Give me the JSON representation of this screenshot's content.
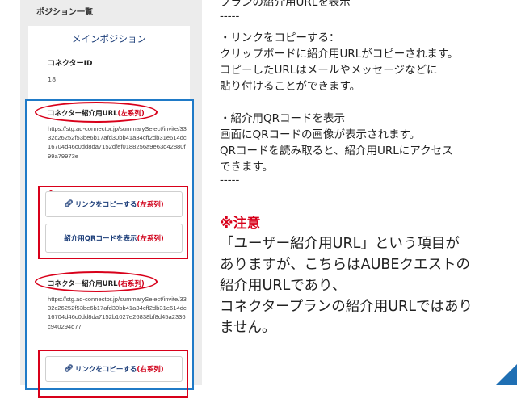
{
  "phone": {
    "section_title": "ポジション一覧",
    "main_position": "メインポジション",
    "connector_id_label": "コネクターID",
    "connector_id_value": "18",
    "left_url_label": "コネクター紹介用URL",
    "left_url_tag": "(左系列)",
    "left_url": "https://stg.aq-connector.jp/summarySelect/invite/3332c26252f53be6b17afd30bb41a34cff2db31e614dc16704d46c0dd8da7152dfef0188256a9e63d42880f99a79973e",
    "copy_left_label": "リンクをコピーする",
    "copy_left_tag": "(左系列)",
    "qr_left_label": "紹介用QRコードを表示",
    "qr_left_tag": "(左系列)",
    "right_url_label": "コネクター紹介用URL",
    "right_url_tag": "(右系列)",
    "right_url": "https://stg.aq-connector.jp/summarySelect/invite/3332c26252f53be6b17afd30bb41a34cff2db31e614dc16704d46c0dd8da7152b1027e26838bf8d45a2336c940294d77",
    "copy_right_label": "リンクをコピーする",
    "copy_right_tag": "(右系列)"
  },
  "explanation": {
    "line0": "プランの紹介用URLを表示",
    "sep1": "-----",
    "copy_heading": "・リンクをコピーする：",
    "copy_line1": "クリップボードに紹介用URLがコピーされます。",
    "copy_line2": "コピーしたURLはメールやメッセージなどに",
    "copy_line3": "貼り付けることができます。",
    "qr_heading": "・紹介用QRコードを表示",
    "qr_line1": "画面にQRコードの画像が表示されます。",
    "qr_line2": "QRコードを読み取ると、紹介用URLにアクセス",
    "qr_line3": "できます。",
    "sep2": "-----",
    "warn_title": "※注意",
    "warn_l1_a": "「",
    "warn_l1_b": "ユーザー紹介用URL",
    "warn_l1_c": "」という項目が",
    "warn_l2": "ありますが、こちらはAUBEクエストの",
    "warn_l3": "紹介用URLであり、",
    "warn_l4": "コネクタープランの紹介用URLではあり",
    "warn_l5": "ません。"
  },
  "colors": {
    "accent_red": "#d8001a",
    "accent_blue": "#1f7ac7",
    "link_navy": "#1a3c78"
  }
}
